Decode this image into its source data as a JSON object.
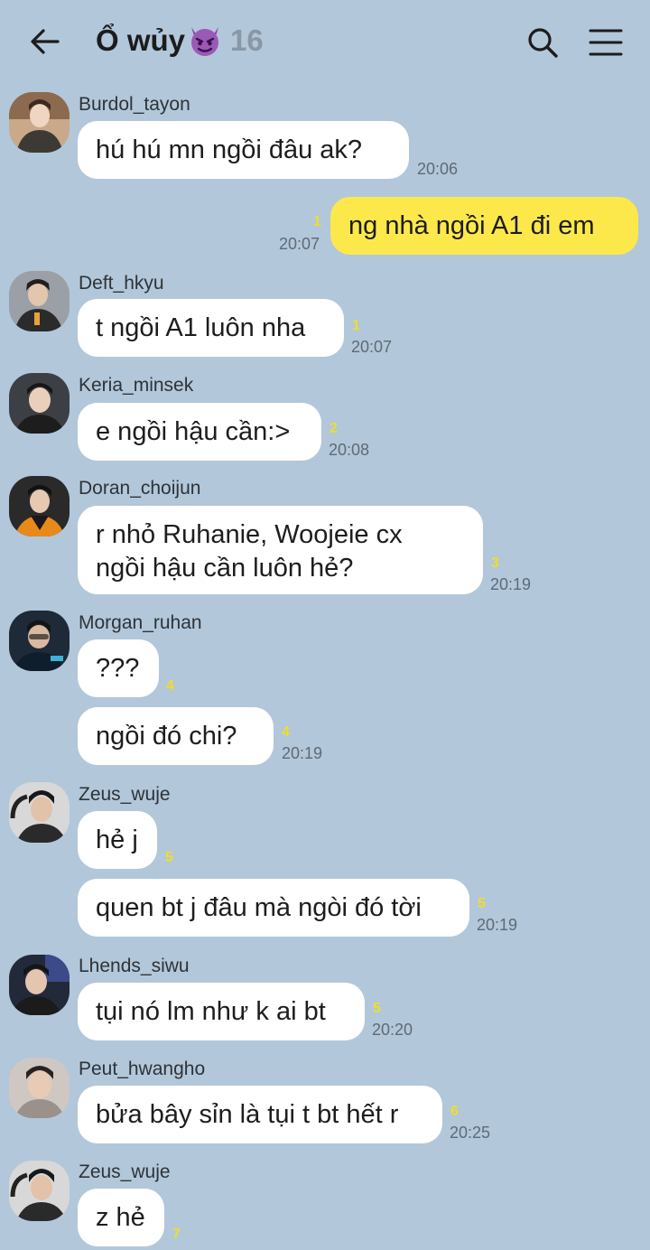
{
  "header": {
    "title": "Ổ wủy",
    "title_emoji": "purple-devil-emoji",
    "member_count": "16"
  },
  "messages": [
    {
      "sender": "Burdol_tayon",
      "text": "hú hú mn ngồi đâu ak?",
      "unread": "",
      "time": "20:06"
    },
    {
      "sender": "",
      "text": "ng nhà ngồi A1 đi em",
      "unread": "1",
      "time": "20:07",
      "mine": true
    },
    {
      "sender": "Deft_hkyu",
      "text": "t ngồi A1 luôn nha",
      "unread": "1",
      "time": "20:07"
    },
    {
      "sender": "Keria_minsek",
      "text": "e ngồi hậu cần:>",
      "unread": "2",
      "time": "20:08"
    },
    {
      "sender": "Doran_choijun",
      "text": "r nhỏ Ruhanie, Woojeie cx\nngồi hậu cần luôn hẻ?",
      "unread": "3",
      "time": "20:19"
    },
    {
      "sender": "Morgan_ruhan",
      "text": "???",
      "unread": "4",
      "time": ""
    },
    {
      "sender": "",
      "text": "ngồi đó chi?",
      "unread": "4",
      "time": "20:19"
    },
    {
      "sender": "Zeus_wuje",
      "text": "hẻ j",
      "unread": "5",
      "time": ""
    },
    {
      "sender": "",
      "text": "quen bt j đâu mà ngòi đó tời",
      "unread": "5",
      "time": "20:19"
    },
    {
      "sender": "Lhends_siwu",
      "text": "tụi nó lm như k ai bt",
      "unread": "5",
      "time": "20:20"
    },
    {
      "sender": "Peut_hwangho",
      "text": "bửa bây sỉn là tụi t bt hết r",
      "unread": "6",
      "time": "20:25"
    },
    {
      "sender": "Zeus_wuje",
      "text": "z hẻ",
      "unread": "7",
      "time": ""
    }
  ],
  "colors": {
    "background": "#b2c7da",
    "my_bubble": "#fde84c",
    "other_bubble": "#ffffff",
    "unread_count": "#f0dd2a"
  }
}
